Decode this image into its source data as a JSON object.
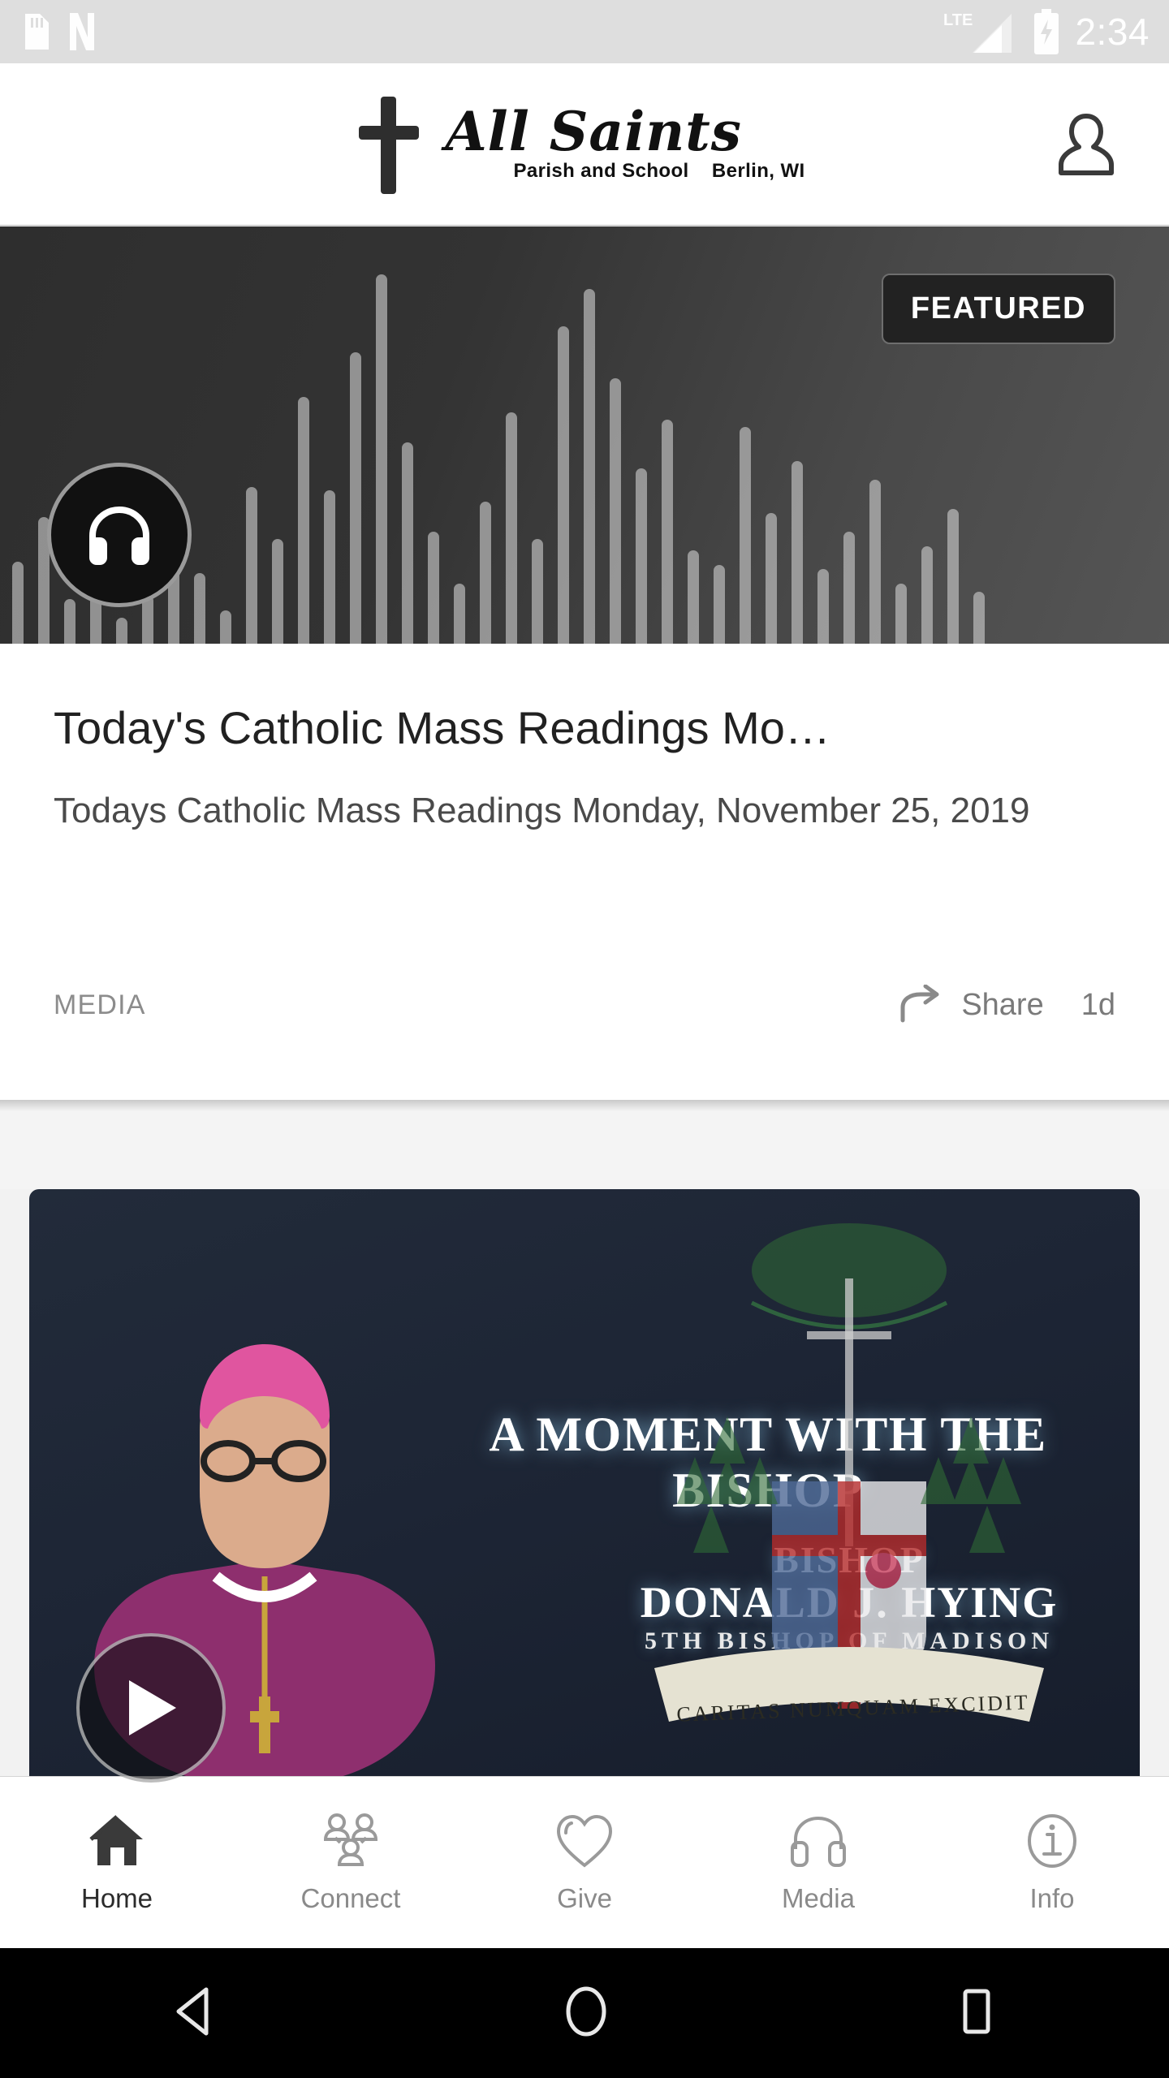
{
  "statusbar": {
    "time": "2:34",
    "network_label": "LTE",
    "icons": [
      "sd-card-icon",
      "netflix-n-icon",
      "lte-signal-icon",
      "battery-charging-icon"
    ]
  },
  "header": {
    "logo_script": "All Saints",
    "logo_subtitle": "Parish and School    Berlin, WI",
    "cross_icon": "cross-icon",
    "profile_icon": "profile-person-icon"
  },
  "featured": {
    "badge": "FEATURED",
    "media_icon": "headphones-icon",
    "waveform": [
      22,
      34,
      12,
      26,
      7,
      13,
      30,
      19,
      9,
      42,
      28,
      66,
      41,
      78,
      99,
      54,
      30,
      16,
      38,
      62,
      28,
      85,
      95,
      71,
      47,
      60,
      25,
      21,
      58,
      35,
      49,
      20,
      30,
      44,
      16,
      26,
      36,
      14
    ]
  },
  "post": {
    "title": "Today's Catholic Mass Readings Mo…",
    "description": "Todays Catholic Mass Readings Monday, November 25, 2019",
    "category": "MEDIA",
    "share_label": "Share",
    "share_icon": "share-arrow-icon",
    "age": "1d"
  },
  "video_post": {
    "play_icon": "play-icon",
    "overlay_title": "A MOMENT WITH THE BISHOP",
    "overlay_bishop_label": "BISHOP",
    "overlay_bishop_name": "DONALD J. HYING",
    "overlay_bishop_rank": "5TH BISHOP OF MADISON",
    "overlay_motto": "CARITAS NUMQUAM EXCIDIT"
  },
  "tabbar": {
    "items": [
      {
        "label": "Home",
        "icon": "home-icon",
        "active": true
      },
      {
        "label": "Connect",
        "icon": "people-group-icon",
        "active": false
      },
      {
        "label": "Give",
        "icon": "heart-icon",
        "active": false
      },
      {
        "label": "Media",
        "icon": "headphones-icon",
        "active": false
      },
      {
        "label": "Info",
        "icon": "info-circle-icon",
        "active": false
      }
    ]
  },
  "android_nav": {
    "back_icon": "back-triangle-icon",
    "home_icon": "home-circle-icon",
    "recents_icon": "recents-square-icon"
  },
  "colors": {
    "status_bar_bg": "#dedede",
    "card_bg": "#ffffff",
    "page_bg": "#f4f4f4",
    "badge_bg": "#222222",
    "active_tab": "#2b2b2b",
    "inactive_tab": "#8a8a8a",
    "video_bg": "#1d2535"
  }
}
